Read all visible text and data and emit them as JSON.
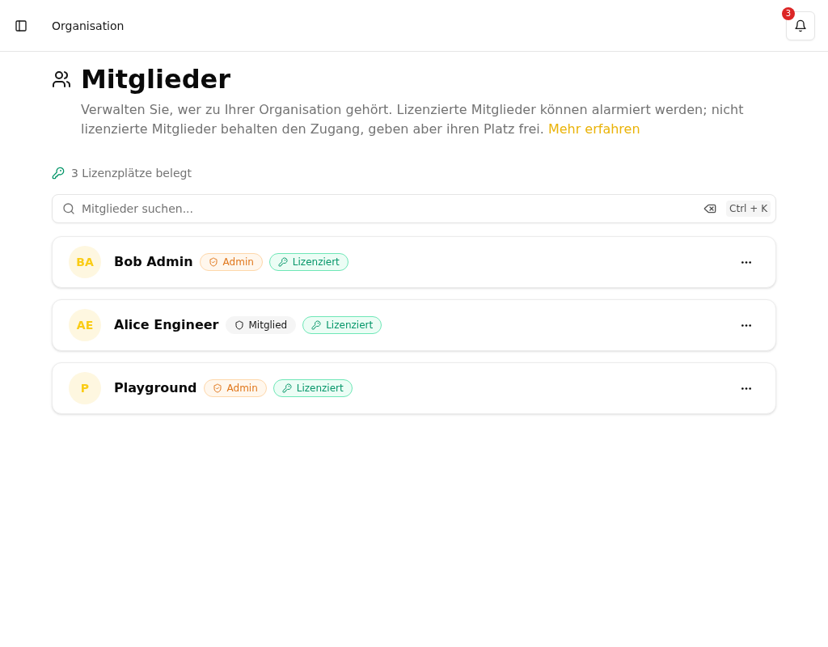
{
  "header": {
    "title": "Organisation",
    "notifications": {
      "count": "3"
    }
  },
  "page": {
    "title": "Mitglieder",
    "description": "Verwalten Sie, wer zu Ihrer Organisation gehört. Lizenzierte Mitglieder können alarmiert werden; nicht lizenzierte Mitglieder behalten den Zugang, geben aber ihren Platz frei.",
    "link": "Mehr erfahren"
  },
  "license_summary": "3 Lizenzplätze belegt",
  "search": {
    "placeholder": "Mitglieder suchen...",
    "shortcut": "Ctrl + K"
  },
  "members": [
    {
      "initials": "BA",
      "name": "Bob Admin",
      "role": {
        "kind": "admin",
        "label": "Admin"
      },
      "license": {
        "kind": "licensed",
        "label": "Lizenziert"
      }
    },
    {
      "initials": "AE",
      "name": "Alice Engineer",
      "role": {
        "kind": "member",
        "label": "Mitglied"
      },
      "license": {
        "kind": "licensed",
        "label": "Lizenziert"
      }
    },
    {
      "initials": "P",
      "name": "Playground",
      "role": {
        "kind": "admin",
        "label": "Admin"
      },
      "license": {
        "kind": "licensed",
        "label": "Lizenziert"
      }
    }
  ]
}
